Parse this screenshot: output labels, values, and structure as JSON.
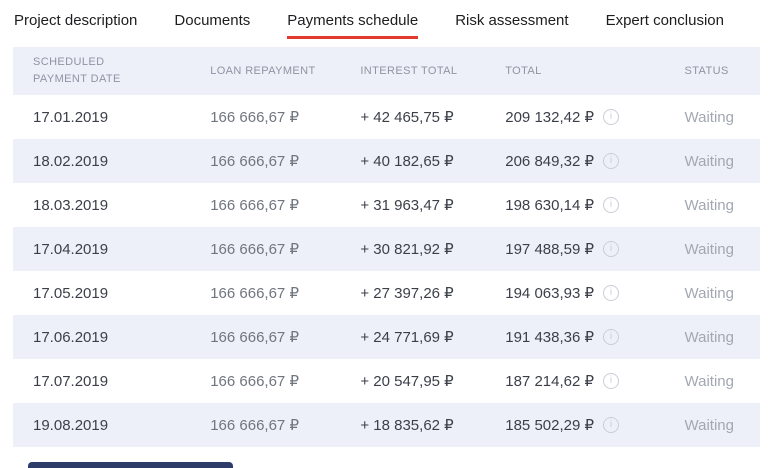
{
  "tabs": [
    {
      "label": "Project description",
      "active": false
    },
    {
      "label": "Documents",
      "active": false
    },
    {
      "label": "Payments schedule",
      "active": true
    },
    {
      "label": "Risk assessment",
      "active": false
    },
    {
      "label": "Expert conclusion",
      "active": false
    }
  ],
  "table": {
    "headers": [
      "Scheduled payment date",
      "Loan repayment",
      "Interest total",
      "Total",
      "Status"
    ],
    "rows": [
      {
        "date": "17.01.2019",
        "loan_repayment": "166 666,67 ₽",
        "interest_total": "+ 42 465,75 ₽",
        "total": "209 132,42 ₽",
        "status": "Waiting"
      },
      {
        "date": "18.02.2019",
        "loan_repayment": "166 666,67 ₽",
        "interest_total": "+ 40 182,65 ₽",
        "total": "206 849,32 ₽",
        "status": "Waiting"
      },
      {
        "date": "18.03.2019",
        "loan_repayment": "166 666,67 ₽",
        "interest_total": "+ 31 963,47 ₽",
        "total": "198 630,14 ₽",
        "status": "Waiting"
      },
      {
        "date": "17.04.2019",
        "loan_repayment": "166 666,67 ₽",
        "interest_total": "+ 30 821,92 ₽",
        "total": "197 488,59 ₽",
        "status": "Waiting"
      },
      {
        "date": "17.05.2019",
        "loan_repayment": "166 666,67 ₽",
        "interest_total": "+ 27 397,26 ₽",
        "total": "194 063,93 ₽",
        "status": "Waiting"
      },
      {
        "date": "17.06.2019",
        "loan_repayment": "166 666,67 ₽",
        "interest_total": "+ 24 771,69 ₽",
        "total": "191 438,36 ₽",
        "status": "Waiting"
      },
      {
        "date": "17.07.2019",
        "loan_repayment": "166 666,67 ₽",
        "interest_total": "+ 20 547,95 ₽",
        "total": "187 214,62 ₽",
        "status": "Waiting"
      },
      {
        "date": "19.08.2019",
        "loan_repayment": "166 666,67 ₽",
        "interest_total": "+ 18 835,62 ₽",
        "total": "185 502,29 ₽",
        "status": "Waiting"
      }
    ]
  },
  "icons": {
    "info_glyph": "i"
  },
  "colors": {
    "accent_red": "#e23a2e",
    "row_alt": "#edf0f8",
    "text_dark": "#3b3f48",
    "text_mid": "#70757f",
    "status_gray": "#a2a7b2",
    "header_text": "#8f94a3",
    "partial_button_navy": "#2e3c6a"
  }
}
